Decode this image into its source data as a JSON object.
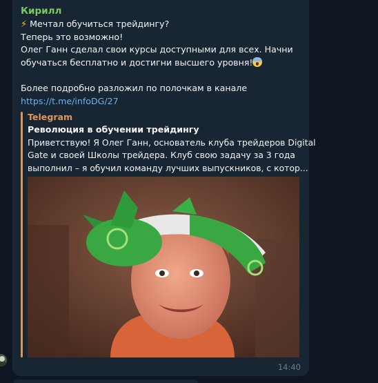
{
  "message": {
    "sender": "Кирилл",
    "lines": [
      "Мечтал обучиться трейдингу?",
      "Теперь это возможно!",
      "Олег Ганн сделал свои курсы доступными для всех. Начни",
      "обучаться бесплатно и достигни высшего уровня!",
      "",
      "Более подробно разложил по полочкам в канале"
    ],
    "link": "https://t.me/infoDG/27",
    "time": "14:40",
    "icons": {
      "line1": "lightning-emoji",
      "line4": "screaming-face-emoji"
    }
  },
  "preview": {
    "site": "Telegram",
    "title": "Революция в обучении трейдингу",
    "description": [
      "Приветствую! Я Олег Ганн, основатель клуба трейдеров Digital",
      "Gate  и своей Школы трейдера. Клуб свою задачу за 3 года",
      "выполнил – я обучил команду лучших выпускников, с котор..."
    ]
  },
  "colors": {
    "background": "#0e1621",
    "bubble": "#182533",
    "sender": "#7bc862",
    "link": "#6ab2f2",
    "preview_accent": "#e29558",
    "time": "#6d7f8f"
  }
}
